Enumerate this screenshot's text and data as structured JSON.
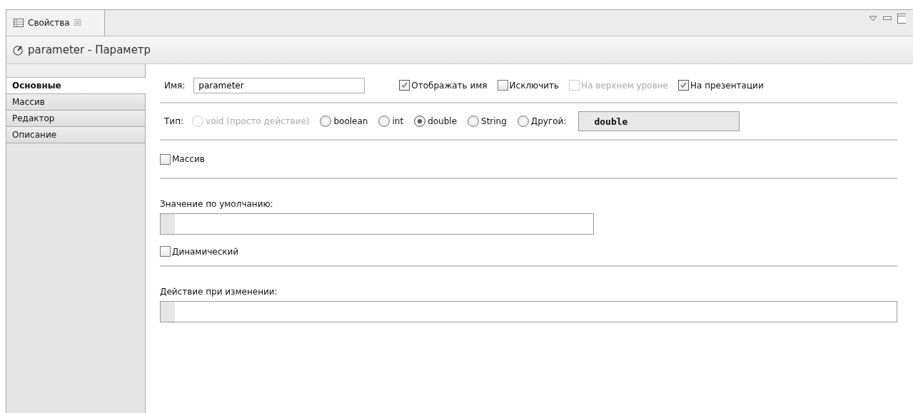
{
  "tab": {
    "label": "Свойства",
    "close": "☒",
    "selected": true
  },
  "header": {
    "title": "parameter - Параметр"
  },
  "sidebar": {
    "items": [
      {
        "label": "Основные",
        "selected": true
      },
      {
        "label": "Массив",
        "selected": false
      },
      {
        "label": "Редактор",
        "selected": false
      },
      {
        "label": "Описание",
        "selected": false
      }
    ]
  },
  "name_row": {
    "label": "Имя:",
    "value": "parameter",
    "checkboxes": [
      {
        "label": "Отображать имя",
        "checked": true,
        "disabled": false
      },
      {
        "label": "Исключить",
        "checked": false,
        "disabled": false
      },
      {
        "label": "На верхнем уровне",
        "checked": false,
        "disabled": true
      },
      {
        "label": "На презентации",
        "checked": true,
        "disabled": false
      }
    ]
  },
  "type_row": {
    "label": "Тип:",
    "options": [
      {
        "label": "void (просто действие)",
        "selected": false,
        "disabled": true
      },
      {
        "label": "boolean",
        "selected": false,
        "disabled": false
      },
      {
        "label": "int",
        "selected": false,
        "disabled": false
      },
      {
        "label": "double",
        "selected": true,
        "disabled": false
      },
      {
        "label": "String",
        "selected": false,
        "disabled": false
      },
      {
        "label": "Другой:",
        "selected": false,
        "disabled": false
      }
    ],
    "other_value": "double"
  },
  "array_checkbox": {
    "label": "Массив",
    "checked": false
  },
  "default_value": {
    "label": "Значение по умолчанию:"
  },
  "dynamic_checkbox": {
    "label": "Динамический",
    "checked": false
  },
  "on_change": {
    "label": "Действие при изменении:"
  }
}
